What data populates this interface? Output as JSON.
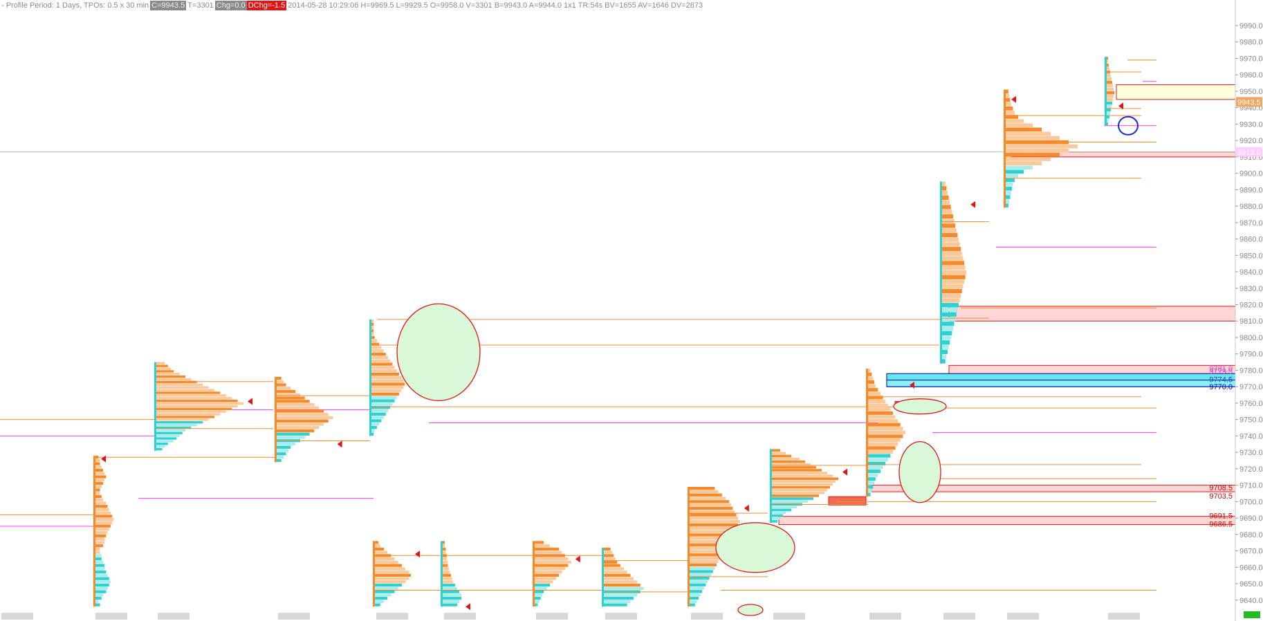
{
  "header": {
    "period_text": "- Profile Period: 1 Days, TPOs: 0.5 x 30 min",
    "close_badge": "C=9943.5",
    "ticks_text": "T=3301",
    "chg_badge": "Chg=0.0",
    "dchg_badge": "DChg=-1.5",
    "details_text": "2014-05-28 10:29:06 H=9969.5 L=9929.5 O=9958.0 V=3301 B=9943.0 A=9944.0 1x1 TR:54s BV=1655 AV=1646 DV=2873",
    "badge_gray_color": "#8a8a8a",
    "badge_red_color": "#e31414"
  },
  "chart_data": {
    "type": "market-profile",
    "y_axis": {
      "min": 9634,
      "max": 9998,
      "ticks": [
        9640.0,
        9650.0,
        9660.0,
        9670.0,
        9680.0,
        9690.0,
        9700.0,
        9710.0,
        9720.0,
        9730.0,
        9740.0,
        9750.0,
        9760.0,
        9770.0,
        9780.0,
        9790.0,
        9800.0,
        9810.0,
        9820.0,
        9830.0,
        9840.0,
        9850.0,
        9860.0,
        9870.0,
        9880.0,
        9890.0,
        9900.0,
        9910.0,
        9920.0,
        9930.0,
        9940.0,
        9950.0,
        9960.0,
        9970.0,
        9980.0,
        9990.0
      ],
      "tick_labels": [
        "9640.0",
        "9650.0",
        "9660.0",
        "9670.0",
        "9680.0",
        "9690.0",
        "9700.0",
        "9710.0",
        "9720.0",
        "9730.0",
        "9740.0",
        "9750.0",
        "9760.0",
        "9770.0",
        "9780.0",
        "9790.0",
        "9800.0",
        "9810.0",
        "9820.0",
        "9830.0",
        "9840.0",
        "9850.0",
        "9860.0",
        "9870.0",
        "9880.0",
        "9890.0",
        "9900.0",
        "9910.0",
        "9920.0",
        "9930.0",
        "9940.0",
        "9950.0",
        "9960.0",
        "9970.0",
        "9980.0",
        "9990.0"
      ]
    },
    "current_price": {
      "value": 9943.5,
      "label": "9943.5",
      "color": "#f4a460"
    },
    "crosshair": {
      "value": 9913.0,
      "label": "9913.0",
      "color": "#ff99ff"
    },
    "price_labels": [
      {
        "value": 9781.0,
        "text": "9781.0",
        "color": "#cc44cc"
      },
      {
        "value": 9779.5,
        "text": "9779.5",
        "color": "#cc44cc"
      },
      {
        "value": 9774.5,
        "text": "9774.5",
        "color": "#3344aa"
      },
      {
        "value": 9770.0,
        "text": "9770.0",
        "color": "#0000cc"
      },
      {
        "value": 9708.5,
        "text": "9708.5",
        "color": "#cc0000"
      },
      {
        "value": 9703.5,
        "text": "9703.5",
        "color": "#cc0000"
      },
      {
        "value": 9691.5,
        "text": "9691.5",
        "color": "#cc0000"
      },
      {
        "value": 9686.5,
        "text": "9686.5",
        "color": "#cc0000"
      }
    ],
    "colors": {
      "orange": "#f58a2a",
      "light_orange": "#fbc89a",
      "cyan": "#2ed0d0",
      "light_cyan": "#a8ecec",
      "poc_red": "#e31414",
      "va_line": "#f58a2a",
      "magenta": "#ff33ff",
      "zone_red": "#ffd6d6",
      "zone_red_border": "#e31414",
      "zone_yellow": "#ffffdd",
      "zone_cyan": "#66e6f0",
      "ellipse_fill": "#d8f8d8",
      "ellipse_border": "#e31414"
    },
    "profiles": [
      {
        "start": 9636,
        "end": 9728,
        "poc": 9726,
        "shape": [
          3,
          2,
          4,
          5,
          7,
          8,
          9,
          10,
          9,
          8,
          7,
          6,
          6,
          5,
          4,
          4,
          3,
          3,
          5,
          6,
          6,
          7,
          8,
          9,
          10,
          11,
          12,
          11,
          10,
          9,
          8,
          7,
          5,
          4,
          3,
          3,
          4,
          5,
          6,
          7,
          6,
          5,
          4,
          3,
          3,
          2
        ]
      },
      {
        "start": 9731,
        "end": 9785,
        "poc": 9761,
        "shape": [
          2,
          3,
          4,
          6,
          7,
          8,
          9,
          10,
          12,
          14,
          16,
          18,
          20,
          22,
          24,
          26,
          28,
          30,
          28,
          26,
          24,
          22,
          20,
          18,
          16,
          14,
          12,
          10,
          8,
          6,
          5,
          4,
          3
        ]
      },
      {
        "start": 9724,
        "end": 9776,
        "poc": 9735,
        "shape": [
          2,
          3,
          4,
          5,
          6,
          8,
          10,
          12,
          14,
          16,
          18,
          20,
          22,
          24,
          22,
          20,
          18,
          16,
          14,
          12,
          10,
          8,
          6,
          4,
          3,
          2
        ]
      },
      {
        "start": 9740,
        "end": 9811,
        "poc": 9758,
        "shape": [
          2,
          3,
          5,
          7,
          9,
          11,
          13,
          15,
          17,
          19,
          21,
          23,
          25,
          27,
          29,
          30,
          29,
          27,
          25,
          23,
          21,
          19,
          17,
          15,
          13,
          11,
          9,
          7,
          5,
          3,
          2,
          2,
          2,
          2,
          2
        ]
      },
      {
        "start": 9636,
        "end": 9676,
        "poc": 9668,
        "shape": [
          3,
          5,
          7,
          9,
          11,
          13,
          15,
          17,
          19,
          20,
          19,
          17,
          15,
          13,
          11,
          9,
          7,
          5,
          3,
          2
        ]
      },
      {
        "start": 9636,
        "end": 9676,
        "poc": 9636,
        "shape": [
          14,
          16,
          18,
          18,
          16,
          14,
          12,
          10,
          9,
          8,
          7,
          6,
          5,
          5,
          4,
          4,
          3,
          3,
          2,
          2
        ]
      },
      {
        "start": 9636,
        "end": 9676,
        "poc": 9665,
        "shape": [
          2,
          3,
          4,
          5,
          6,
          8,
          10,
          12,
          14,
          16,
          18,
          20,
          22,
          24,
          22,
          20,
          18,
          16,
          10,
          6
        ]
      },
      {
        "start": 9636,
        "end": 9672,
        "poc": 9665,
        "shape": [
          14,
          16,
          18,
          20,
          22,
          24,
          22,
          20,
          18,
          16,
          14,
          12,
          10,
          8,
          7,
          6,
          5,
          4
        ]
      },
      {
        "start": 9636,
        "end": 9709,
        "poc": 9696,
        "shape": [
          3,
          4,
          5,
          6,
          7,
          8,
          9,
          10,
          11,
          12,
          13,
          14,
          15,
          16,
          17,
          18,
          19,
          20,
          21,
          22,
          23,
          24,
          25,
          26,
          27,
          28,
          27,
          26,
          25,
          24,
          23,
          22,
          20,
          18,
          16,
          14
        ]
      },
      {
        "start": 9687,
        "end": 9732,
        "poc": 9718,
        "shape": [
          4,
          6,
          8,
          10,
          14,
          18,
          22,
          26,
          30,
          34,
          38,
          40,
          42,
          44,
          46,
          48,
          44,
          40,
          36,
          32,
          28,
          24,
          20,
          14,
          10,
          6
        ]
      },
      {
        "start": 9703,
        "end": 9781,
        "poc": 9771,
        "shape": [
          2,
          3,
          4,
          5,
          6,
          8,
          10,
          12,
          14,
          16,
          18,
          20,
          22,
          24,
          26,
          28,
          30,
          28,
          26,
          24,
          22,
          20,
          18,
          16,
          14,
          12,
          10,
          8,
          6,
          5,
          4,
          3,
          2
        ]
      },
      {
        "start": 9784,
        "end": 9895,
        "poc": 9881,
        "shape": [
          3,
          4,
          5,
          6,
          7,
          8,
          9,
          10,
          11,
          12,
          13,
          14,
          15,
          16,
          17,
          18,
          19,
          20,
          21,
          22,
          21,
          20,
          19,
          18,
          17,
          16,
          15,
          14,
          13,
          12,
          11,
          10,
          9,
          8,
          7,
          6,
          5,
          4,
          3
        ]
      },
      {
        "start": 9879,
        "end": 9951,
        "poc": 9945,
        "shape": [
          3,
          4,
          5,
          6,
          7,
          8,
          10,
          14,
          20,
          30,
          40,
          50,
          60,
          70,
          80,
          70,
          60,
          50,
          40,
          30,
          20,
          14,
          10,
          8,
          6,
          5,
          4,
          3
        ]
      },
      {
        "start": 9929,
        "end": 9971,
        "poc": 9941,
        "shape": [
          2,
          3,
          4,
          5,
          6,
          7,
          8,
          9,
          10,
          11,
          10,
          9,
          8,
          7,
          6,
          5,
          4,
          3,
          2,
          2
        ]
      }
    ],
    "zones": [
      {
        "from": 9910,
        "to": 9913,
        "color": "red"
      },
      {
        "from": 9810,
        "to": 9819,
        "color": "red"
      },
      {
        "from": 9777,
        "to": 9783,
        "color": "red"
      },
      {
        "from": 9770,
        "to": 9778,
        "color": "cyan"
      },
      {
        "from": 9706,
        "to": 9710,
        "color": "red"
      },
      {
        "from": 9686,
        "to": 9691,
        "color": "red"
      },
      {
        "from": 9945,
        "to": 9954,
        "color": "yellow"
      }
    ]
  }
}
